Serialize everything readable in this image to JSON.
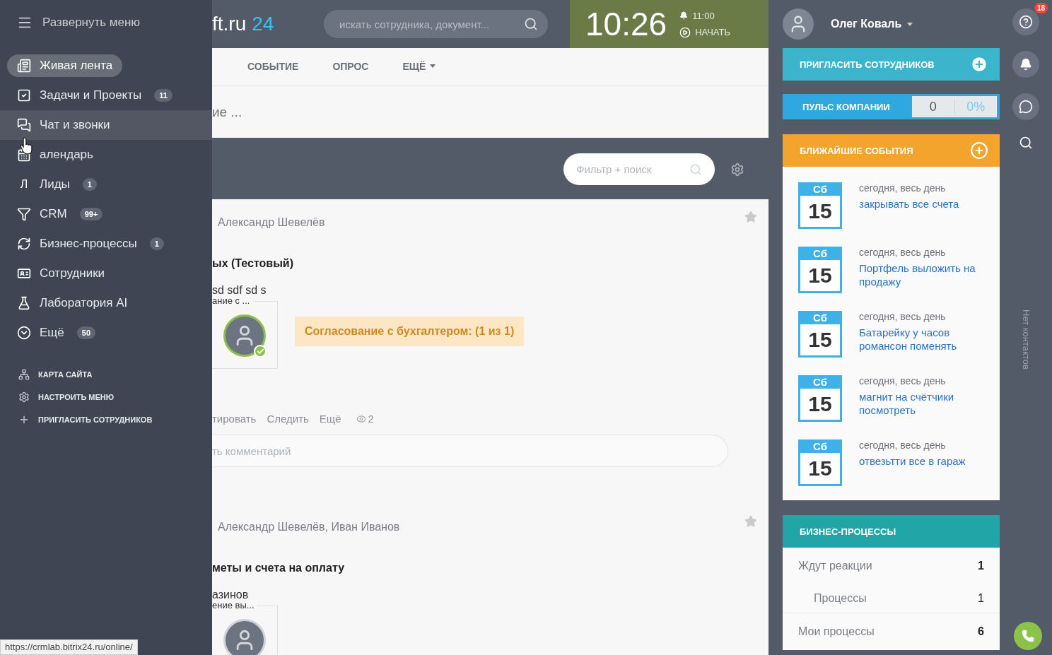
{
  "menu": {
    "toggle_label": "Развернуть меню",
    "items": [
      {
        "label": "Живая лента",
        "selected": true,
        "hovered": false
      },
      {
        "label": "Задачи и Проекты",
        "counter": "11",
        "selected": false,
        "hovered": false
      },
      {
        "label": "Чат и звонки",
        "selected": false,
        "hovered": true
      },
      {
        "label": "алендарь",
        "selected": false,
        "hovered": false
      },
      {
        "label": "Лиды",
        "letter": "Л",
        "counter": "1",
        "selected": false,
        "hovered": false
      },
      {
        "label": "CRM",
        "counter": "99+",
        "selected": false,
        "hovered": false
      },
      {
        "label": "Бизнес-процессы",
        "counter": "1",
        "selected": false,
        "hovered": false
      },
      {
        "label": "Сотрудники",
        "selected": false,
        "hovered": false
      },
      {
        "label": "Лаборатория AI",
        "selected": false,
        "hovered": false
      },
      {
        "label": "Ещё",
        "counter": "50",
        "selected": false,
        "hovered": false
      }
    ],
    "links": [
      "КАРТА САЙТА",
      "НАСТРОИТЬ МЕНЮ",
      "ПРИГЛАСИТЬ СОТРУДНИКОВ"
    ]
  },
  "header": {
    "logo_text": "ft.ru",
    "logo_number": "24",
    "search_placeholder": "искать сотрудника, документ...",
    "clock": "10:26",
    "alarm": "11:00",
    "start_label": "НАЧАТЬ"
  },
  "composer": {
    "tabs": [
      {
        "label": "СОБЫТИЕ",
        "selected": false,
        "has_menu": false
      },
      {
        "label": "ОПРОС",
        "selected": false,
        "has_menu": false
      },
      {
        "label": "ЕЩЁ",
        "selected": false,
        "has_menu": true
      }
    ],
    "placeholder": "ие ..."
  },
  "filter": {
    "placeholder": "Фильтр + поиск"
  },
  "posts": [
    {
      "recipients": "Александр Шевелёв",
      "title": "ых (Тестовый)",
      "text": "sd sdf sd s",
      "approval_label": "ание с ...",
      "approved": true,
      "status": "Согласование с бухгалтером: (1 из 1)",
      "actions": [
        "тировать",
        "Следить",
        "Ещё"
      ],
      "views": "2",
      "comment_placeholder": "ть комментарий"
    },
    {
      "recipients": "Александр Шевелёв, Иван Иванов",
      "title": "меты и счета на оплату",
      "text": "азинов",
      "approval_label": "ение вы..."
    }
  ],
  "user": {
    "name": "Олег Коваль"
  },
  "invite": {
    "label": "ПРИГЛАСИТЬ СОТРУДНИКОВ"
  },
  "pulse": {
    "label": "ПУЛЬС КОМПАНИИ",
    "count": "0",
    "percent": "0%"
  },
  "events": {
    "title": "БЛИЖАЙШИЕ СОБЫТИЯ",
    "items": [
      {
        "weekday": "Сб",
        "day": "15",
        "when": "сегодня, весь день",
        "title": "закрывать все счета"
      },
      {
        "weekday": "Сб",
        "day": "15",
        "when": "сегодня, весь день",
        "title": "Портфель выложить на продажу"
      },
      {
        "weekday": "Сб",
        "day": "15",
        "when": "сегодня, весь день",
        "title": "Батарейку у часов романсон поменять"
      },
      {
        "weekday": "Сб",
        "day": "15",
        "when": "сегодня, весь день",
        "title": "магнит на счётчики посмотреть"
      },
      {
        "weekday": "Сб",
        "day": "15",
        "when": "сегодня, весь день",
        "title": "отвезьтти все в гараж"
      }
    ]
  },
  "bizproc": {
    "title": "БИЗНЕС-ПРОЦЕССЫ",
    "rows": [
      {
        "label": "Ждут реакции",
        "count": "1",
        "children": [
          {
            "label": "Процессы",
            "count": "1"
          }
        ]
      },
      {
        "label": "Мои процессы",
        "count": "6"
      }
    ]
  },
  "rail": {
    "help_badge": "18",
    "contacts_label": "Нет контактов"
  },
  "status_url": "https://crmlab.bitrix24.ru/online/"
}
